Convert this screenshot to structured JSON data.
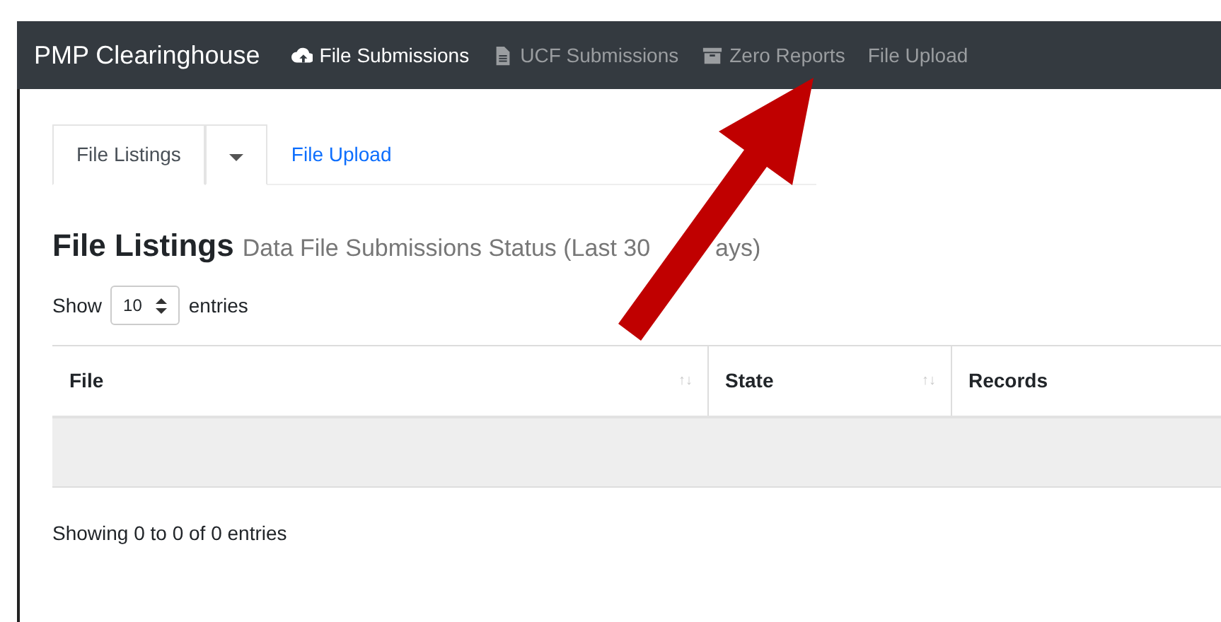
{
  "navbar": {
    "brand": "PMP Clearinghouse",
    "items": [
      {
        "label": "File Submissions",
        "selected": true
      },
      {
        "label": "UCF Submissions",
        "selected": false
      },
      {
        "label": "Zero Reports",
        "selected": false
      },
      {
        "label": "File Upload",
        "selected": false
      }
    ]
  },
  "tabs": [
    {
      "kind": "tab",
      "label": "File Listings",
      "selected": true
    },
    {
      "kind": "dropdown",
      "selected": false
    },
    {
      "kind": "tab",
      "label": "File Upload",
      "selected": false
    }
  ],
  "heading": {
    "title": "File Listings",
    "subtitle_parts": [
      "Data File Submissions Status (Last 30",
      "ays)"
    ]
  },
  "length": {
    "show_label": "Show",
    "value": "10",
    "entries_label": "entries"
  },
  "table": {
    "columns": [
      {
        "label": "File",
        "sort": "↑↓"
      },
      {
        "label": "State",
        "sort": "↑↓"
      },
      {
        "label": "Records"
      }
    ]
  },
  "info": "Showing 0 to 0 of 0 entries"
}
